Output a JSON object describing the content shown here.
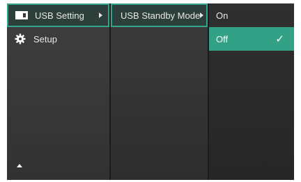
{
  "menu": {
    "main_items": [
      {
        "label": "USB Setting",
        "icon": "usb-icon"
      },
      {
        "label": "Setup",
        "icon": "gear-icon"
      }
    ],
    "submenu_items": [
      {
        "label": "USB Standby Mode"
      }
    ],
    "value_items": [
      {
        "label": "On"
      },
      {
        "label": "Off"
      }
    ],
    "selected_check": "✓"
  },
  "colors": {
    "accent": "#33a186",
    "selected_border": "#34a58c"
  }
}
